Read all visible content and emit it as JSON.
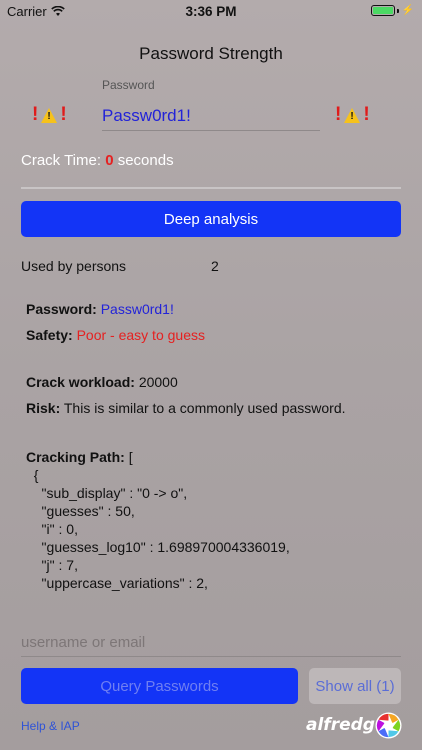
{
  "status_bar": {
    "carrier": "Carrier",
    "time": "3:36 PM",
    "battery_level": 1.0
  },
  "header": {
    "title": "Password Strength"
  },
  "password": {
    "label": "Password",
    "value": "Passw0rd1!",
    "warning_icons": [
      "exclamation-icon",
      "warning-triangle-icon",
      "exclamation-icon"
    ]
  },
  "crack_time": {
    "label": "Crack Time:",
    "value": "0",
    "unit": "seconds",
    "progress": 0
  },
  "deep_analysis_button": "Deep analysis",
  "used_by": {
    "label": "Used by persons",
    "value": "2"
  },
  "report": {
    "password_label": "Password:",
    "password_value": "Passw0rd1!",
    "safety_label": "Safety:",
    "safety_value": "Poor - easy to guess",
    "workload_label": "Crack workload:",
    "workload_value": "20000",
    "risk_label": "Risk:",
    "risk_value": "This is similar to a commonly used password.",
    "cracking_path_label": "Cracking Path:",
    "cracking_path_open": "[",
    "cracking_path_lines": [
      "  {",
      "    \"sub_display\" : \"0 -> o\",",
      "    \"guesses\" : 50,",
      "    \"i\" : 0,",
      "    \"guesses_log10\" : 1.698970004336019,",
      "    \"j\" : 7,",
      "    \"uppercase_variations\" : 2,"
    ]
  },
  "login": {
    "placeholder": "username or email"
  },
  "query_button": "Query Passwords",
  "show_all_button": "Show all (1)",
  "footer": {
    "help_link": "Help & IAP",
    "brand": "alfredg"
  },
  "colors": {
    "accent_blue": "#1334f6",
    "danger_red": "#e52121",
    "password_blue": "#2323d8"
  }
}
